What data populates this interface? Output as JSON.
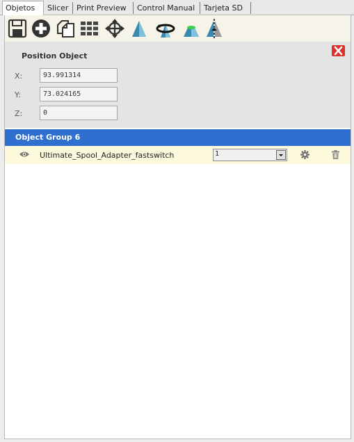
{
  "tabs": [
    {
      "label": "Objetos",
      "active": true
    },
    {
      "label": "Slicer",
      "active": false
    },
    {
      "label": "Print Preview",
      "active": false
    },
    {
      "label": "Control Manual",
      "active": false
    },
    {
      "label": "Tarjeta SD",
      "active": false
    }
  ],
  "toolbar": {
    "icons": [
      "save-icon",
      "add-icon",
      "copy-icon",
      "autoposition-icon",
      "center-icon",
      "scale-icon",
      "rotate-icon",
      "cut-icon",
      "mirror-icon"
    ]
  },
  "position": {
    "title": "Position Object",
    "x_label": "X:",
    "x_value": "93.991314",
    "y_label": "Y:",
    "y_value": "73.024165",
    "z_label": "Z:",
    "z_value": "0"
  },
  "group": {
    "title": "Object Group 6",
    "objects": [
      {
        "name": "Ultimate_Spool_Adapter_fastswitch",
        "copies": "1"
      }
    ]
  },
  "colors": {
    "group_header": "#2f6fd0",
    "row_highlight": "#fcf9dd",
    "close": "#d8322a",
    "toolbar_bg": "#f6f3e8"
  }
}
